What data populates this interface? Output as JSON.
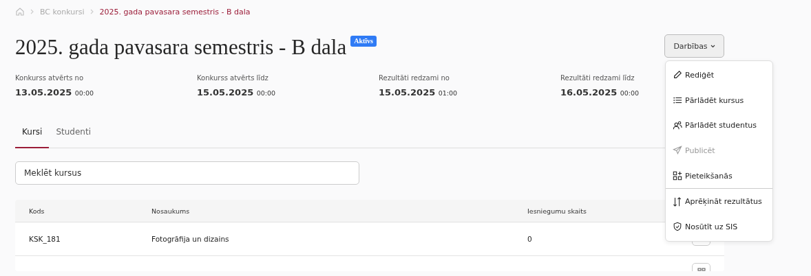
{
  "breadcrumb": [
    {
      "label": "BC konkursi",
      "current": false
    },
    {
      "label": "2025. gada pavasara semestris - B dala",
      "current": true
    }
  ],
  "title": "2025. gada pavasara semestris - B dala",
  "status_badge": "Aktīvs",
  "actions_button": "Darbības",
  "dates": [
    {
      "label": "Konkurss atvērts no",
      "date": "13.05.2025",
      "time": "00:00"
    },
    {
      "label": "Konkurss atvērts līdz",
      "date": "15.05.2025",
      "time": "00:00"
    },
    {
      "label": "Rezultāti redzami no",
      "date": "15.05.2025",
      "time": "01:00"
    },
    {
      "label": "Rezultāti redzami līdz",
      "date": "16.05.2025",
      "time": "00:00"
    }
  ],
  "tabs": [
    {
      "label": "Kursi",
      "selected": true
    },
    {
      "label": "Studenti",
      "selected": false
    }
  ],
  "search": {
    "placeholder": "Meklēt kursus"
  },
  "table": {
    "columns": [
      "Kods",
      "Nosaukums",
      "Iesniegumu skaits"
    ],
    "rows": [
      [
        "KSK_181",
        "Fotogrāfija un dizains",
        "0"
      ]
    ]
  },
  "menu": {
    "groups": [
      [
        {
          "label": "Rediģēt",
          "kind": "pencil",
          "disabled": false
        },
        {
          "label": "Pārlādēt kursus",
          "kind": "list",
          "disabled": false
        },
        {
          "label": "Pārlādēt studentus",
          "kind": "people",
          "disabled": false
        },
        {
          "label": "Publicēt",
          "kind": "plane",
          "disabled": true
        },
        {
          "label": "Pieteikšanās",
          "kind": "grid",
          "disabled": false
        }
      ],
      [
        {
          "label": "Aprēķināt rezultātus",
          "kind": "sort",
          "disabled": false
        },
        {
          "label": "Nosūtīt uz SIS",
          "kind": "shield",
          "disabled": false
        }
      ]
    ]
  }
}
